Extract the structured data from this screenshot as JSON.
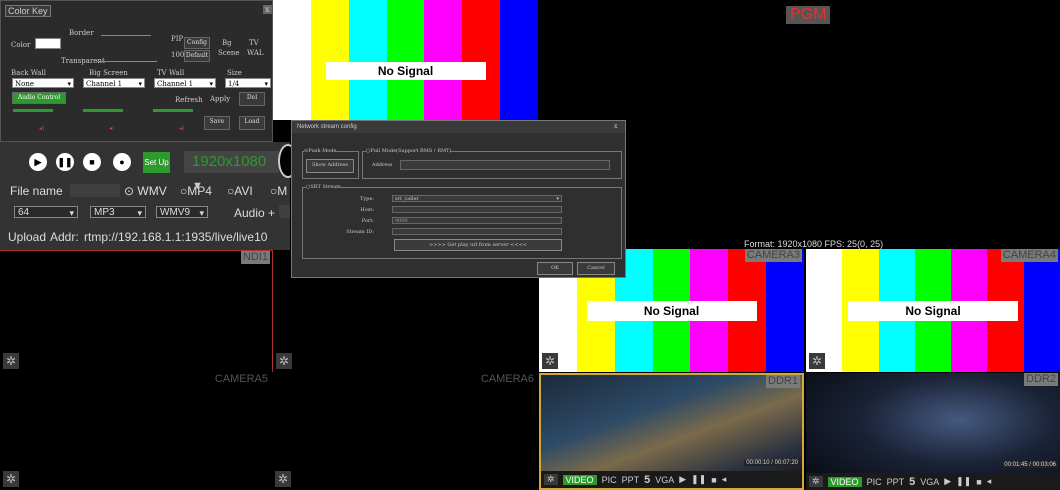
{
  "color_key": {
    "title": "Color Key",
    "close": "x",
    "color_label": "Color",
    "border_label": "Border",
    "transparent_label": "Transparent",
    "pip_label": "PIP",
    "config_label": "Config",
    "rtd": "100",
    "default_label": "Default",
    "bg_label": "Bg",
    "scene_label": "Scene",
    "tv_label": "TV",
    "wal_label": "WAL",
    "back_wall_label": "Back Wall",
    "big_screen_label": "Big Screen",
    "tv_wall_label": "TV Wall",
    "size_label": "Size",
    "back_wall_value": "None",
    "big_screen_value": "Channel 1",
    "tv_wall_value": "Channel 1",
    "size_value": "1/4",
    "audio_control_label": "Audio Control",
    "refresh_label": "Refresh",
    "apply_label": "Apply",
    "del_label": "Del",
    "save_label": "Save",
    "load_label": "Load"
  },
  "record": {
    "setup_label": "Set Up",
    "resolution": "1920x1080",
    "file_name_label": "File name",
    "formats": [
      "WMV",
      "MP4",
      "AVI",
      "M"
    ],
    "bitrate": "64",
    "audio_codec": "MP3",
    "video_codec": "WMV9",
    "audio_plus": "Audio +",
    "upload_label": "Upload",
    "addr_label": "Addr:",
    "addr_value": "rtmp://192.168.1.1:1935/live/live10"
  },
  "dialog": {
    "title": "Network stream config",
    "close": "x",
    "push_mode": "Push Mode",
    "pull_mode": "Pull Mode(Support RMS / RMT)",
    "show_address": "Show Address",
    "address_label": "Address",
    "srt_stream": "SRT Stream",
    "type_label": "Type:",
    "type_value": "srt_caller",
    "host_label": "Host:",
    "port_label": "Port:",
    "port_value": "9000",
    "stream_id_label": "Stream ID:",
    "get_url_label": ">>>> Get play url from server <<<<",
    "ok_label": "OK",
    "cancel_label": "Cancel"
  },
  "pgm": {
    "label": "PGM",
    "format": "Format: 1920x1080 FPS: 25(0, 25)"
  },
  "tiles": {
    "ndi1": "NDI1",
    "camera3": "CAMERA3",
    "camera4": "CAMERA4",
    "camera5": "CAMERA5",
    "camera6": "CAMERA6",
    "ddr1": "DDR1",
    "ddr2": "DDR2"
  },
  "no_signal": "No Signal",
  "ddr": {
    "video": "VIDEO",
    "pic": "PIC",
    "ppt": "PPT",
    "five": "5",
    "vga": "VGA",
    "time1": "00:00:10 / 00:07:20",
    "time2": "00:01:45 / 00:03:06"
  },
  "colors": {
    "bars": [
      "#ffffff",
      "#ffff00",
      "#00ffff",
      "#00ff00",
      "#ff00ff",
      "#ff0000",
      "#0000ff"
    ],
    "accent_green": "#2c9a2c",
    "pgm_label": "#e3322b",
    "selected_border": "#d4a73a"
  }
}
